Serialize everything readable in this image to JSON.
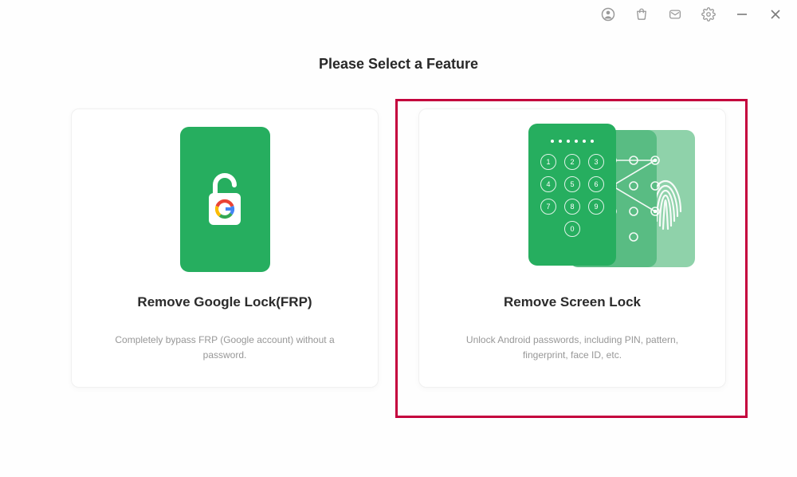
{
  "titlebar": {
    "account_icon": "account-icon",
    "store_icon": "store-icon",
    "mail_icon": "mail-icon",
    "settings_icon": "settings-icon",
    "minimize_icon": "minimize-icon",
    "close_icon": "close-icon"
  },
  "page": {
    "title": "Please Select a Feature"
  },
  "cards": {
    "frp": {
      "title": "Remove Google Lock(FRP)",
      "desc": "Completely bypass FRP (Google account) without a password."
    },
    "screen": {
      "title": "Remove Screen Lock",
      "desc": "Unlock Android passwords, including PIN, pattern, fingerprint, face ID, etc."
    }
  },
  "colors": {
    "accent_green": "#26ae5f",
    "highlight": "#c4003d"
  },
  "highlight": {
    "target": "screen"
  }
}
